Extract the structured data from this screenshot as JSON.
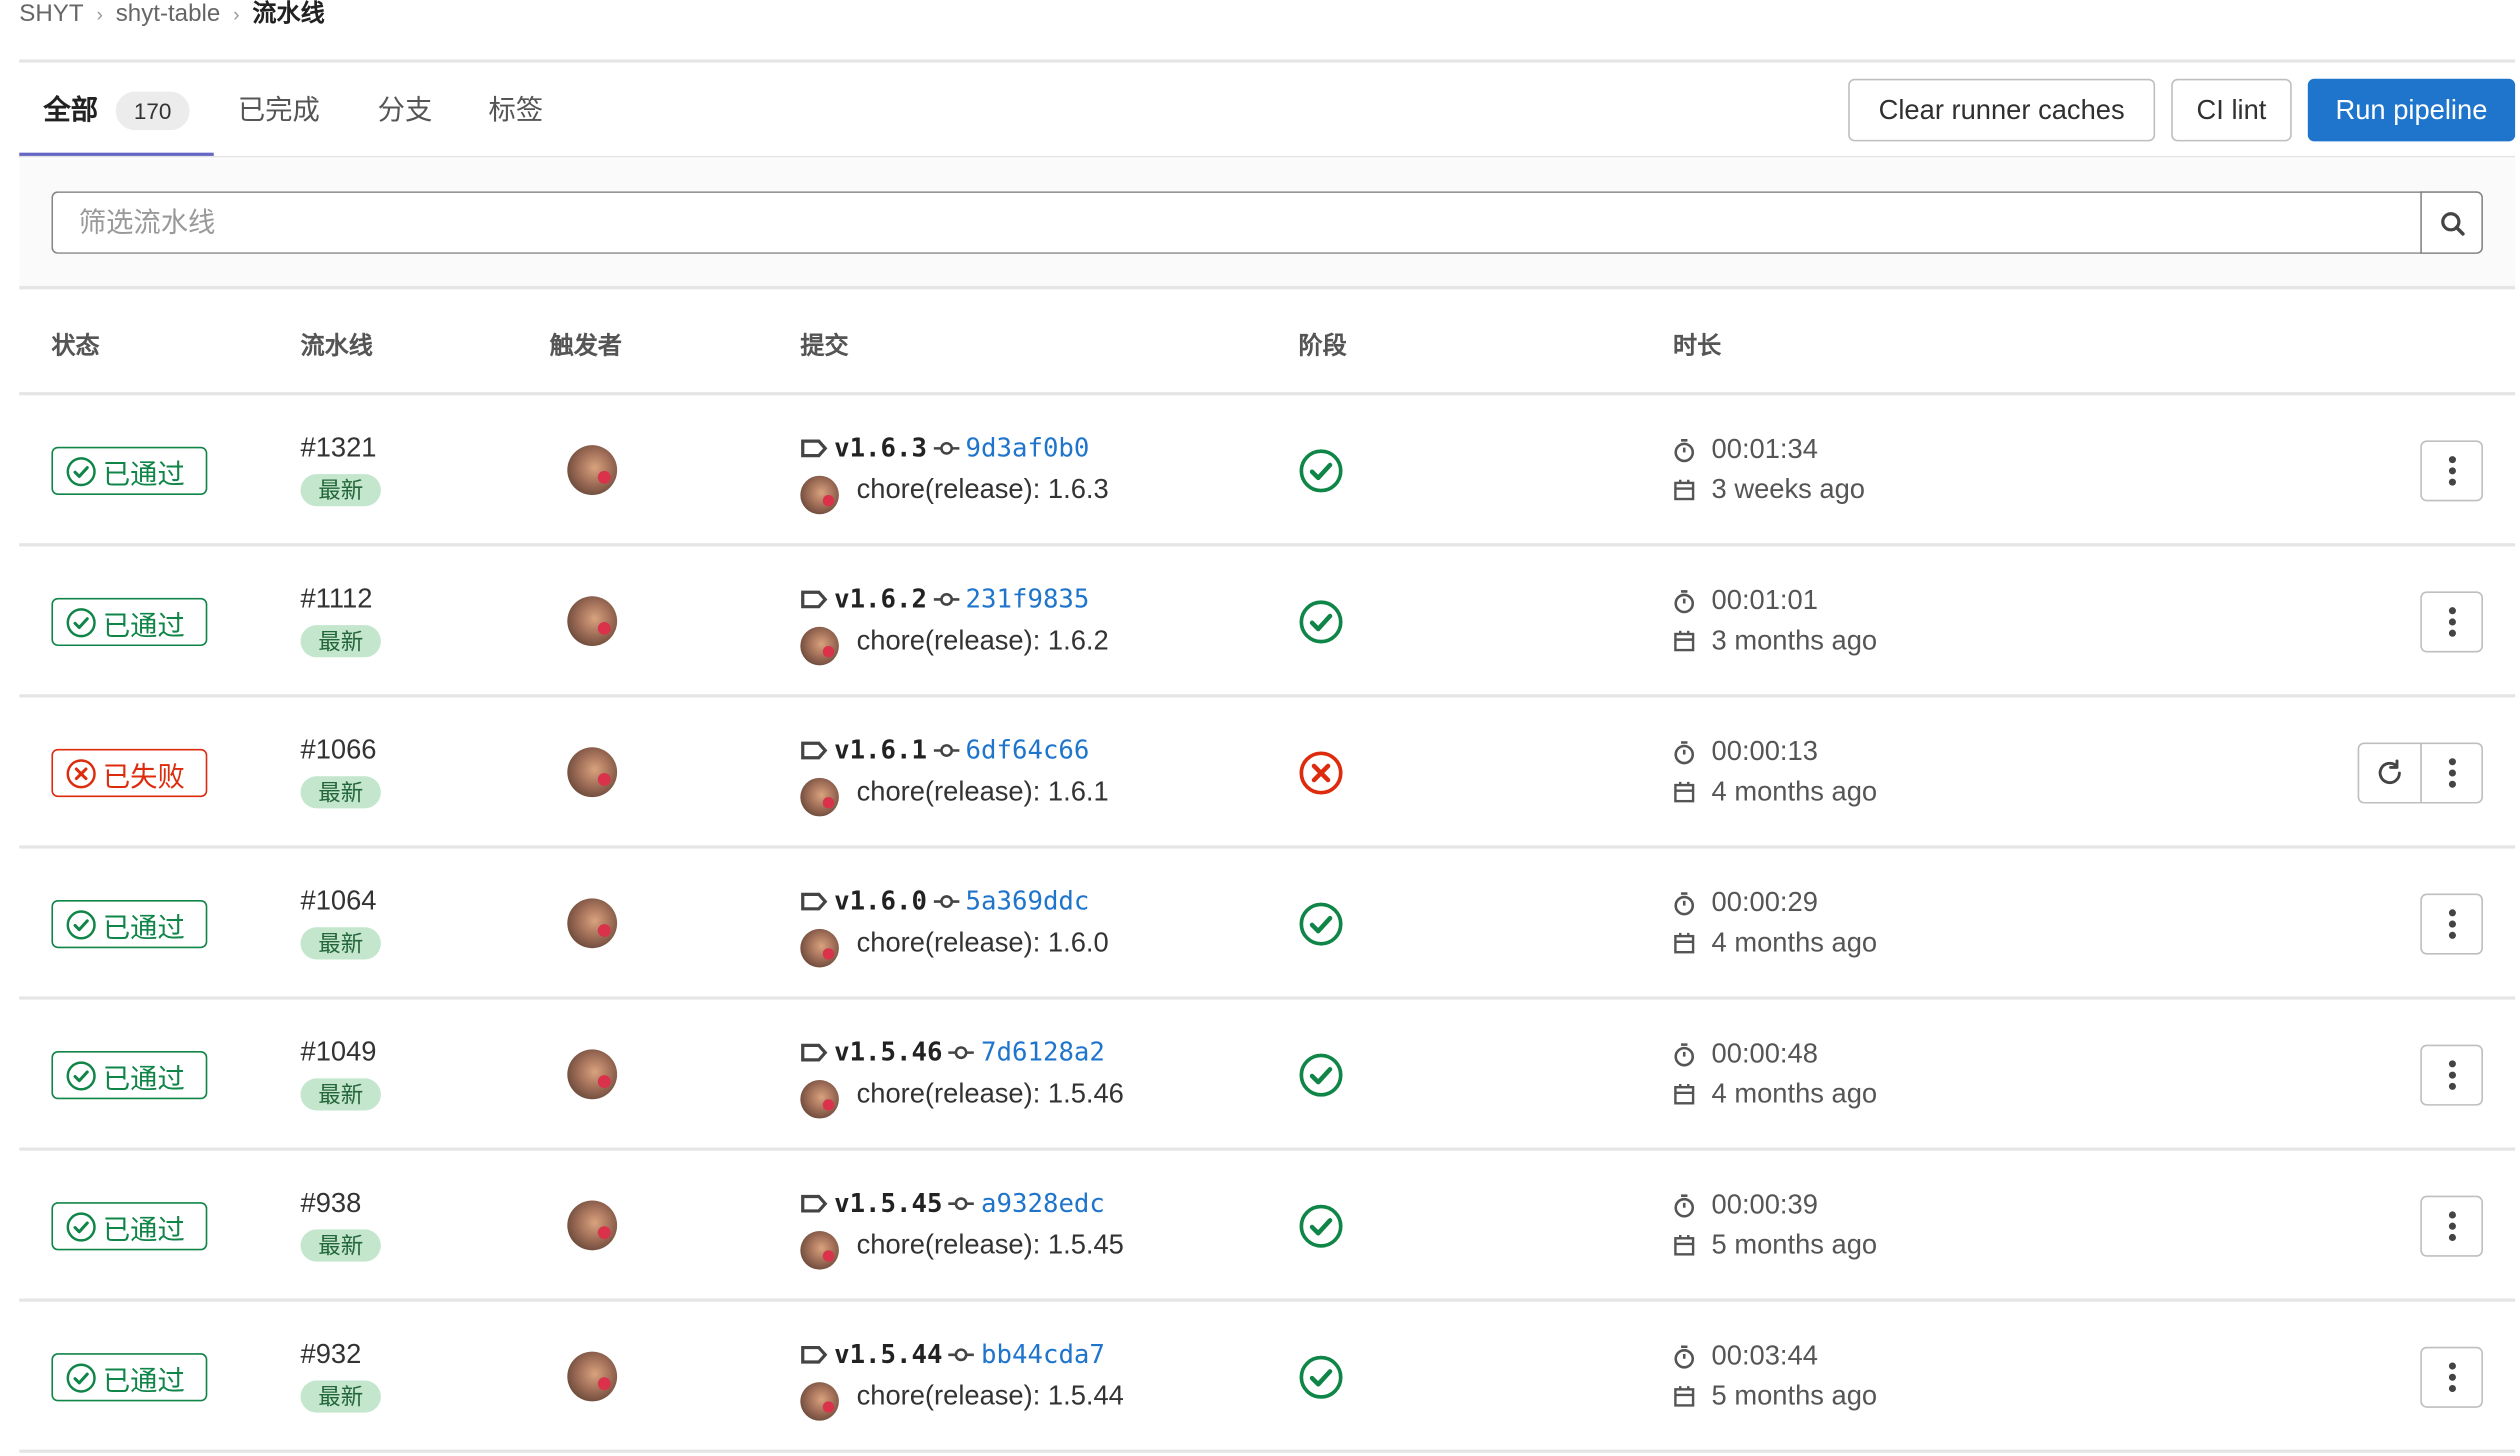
{
  "breadcrumb": [
    "SHYT",
    "shyt-table",
    "流水线"
  ],
  "tabs": [
    {
      "label": "全部",
      "count": "170"
    },
    {
      "label": "已完成"
    },
    {
      "label": "分支"
    },
    {
      "label": "标签"
    }
  ],
  "buttons": {
    "clear_caches": "Clear runner caches",
    "ci_lint": "CI lint",
    "run_pipeline": "Run pipeline"
  },
  "filter": {
    "placeholder": "筛选流水线"
  },
  "columns": [
    "状态",
    "流水线",
    "触发者",
    "提交",
    "阶段",
    "时长"
  ],
  "colors": {
    "success": "#108548",
    "failed": "#dd2b0e",
    "link": "#1f75cb",
    "primary": "#1f75cb",
    "tab_underline": "#6666c4"
  },
  "rows": [
    {
      "status": "已通过",
      "state": "success",
      "id": "#1321",
      "badge": "最新",
      "tag": "v1.6.3",
      "sha": "9d3af0b0",
      "message": "chore(release): 1.6.3",
      "duration": "00:01:34",
      "finished": "3 weeks ago"
    },
    {
      "status": "已通过",
      "state": "success",
      "id": "#1112",
      "badge": "最新",
      "tag": "v1.6.2",
      "sha": "231f9835",
      "message": "chore(release): 1.6.2",
      "duration": "00:01:01",
      "finished": "3 months ago"
    },
    {
      "status": "已失败",
      "state": "failed",
      "id": "#1066",
      "badge": "最新",
      "tag": "v1.6.1",
      "sha": "6df64c66",
      "message": "chore(release): 1.6.1",
      "duration": "00:00:13",
      "finished": "4 months ago"
    },
    {
      "status": "已通过",
      "state": "success",
      "id": "#1064",
      "badge": "最新",
      "tag": "v1.6.0",
      "sha": "5a369ddc",
      "message": "chore(release): 1.6.0",
      "duration": "00:00:29",
      "finished": "4 months ago"
    },
    {
      "status": "已通过",
      "state": "success",
      "id": "#1049",
      "badge": "最新",
      "tag": "v1.5.46",
      "sha": "7d6128a2",
      "message": "chore(release): 1.5.46",
      "duration": "00:00:48",
      "finished": "4 months ago"
    },
    {
      "status": "已通过",
      "state": "success",
      "id": "#938",
      "badge": "最新",
      "tag": "v1.5.45",
      "sha": "a9328edc",
      "message": "chore(release): 1.5.45",
      "duration": "00:00:39",
      "finished": "5 months ago"
    },
    {
      "status": "已通过",
      "state": "success",
      "id": "#932",
      "badge": "最新",
      "tag": "v1.5.44",
      "sha": "bb44cda7",
      "message": "chore(release): 1.5.44",
      "duration": "00:03:44",
      "finished": "5 months ago"
    }
  ]
}
